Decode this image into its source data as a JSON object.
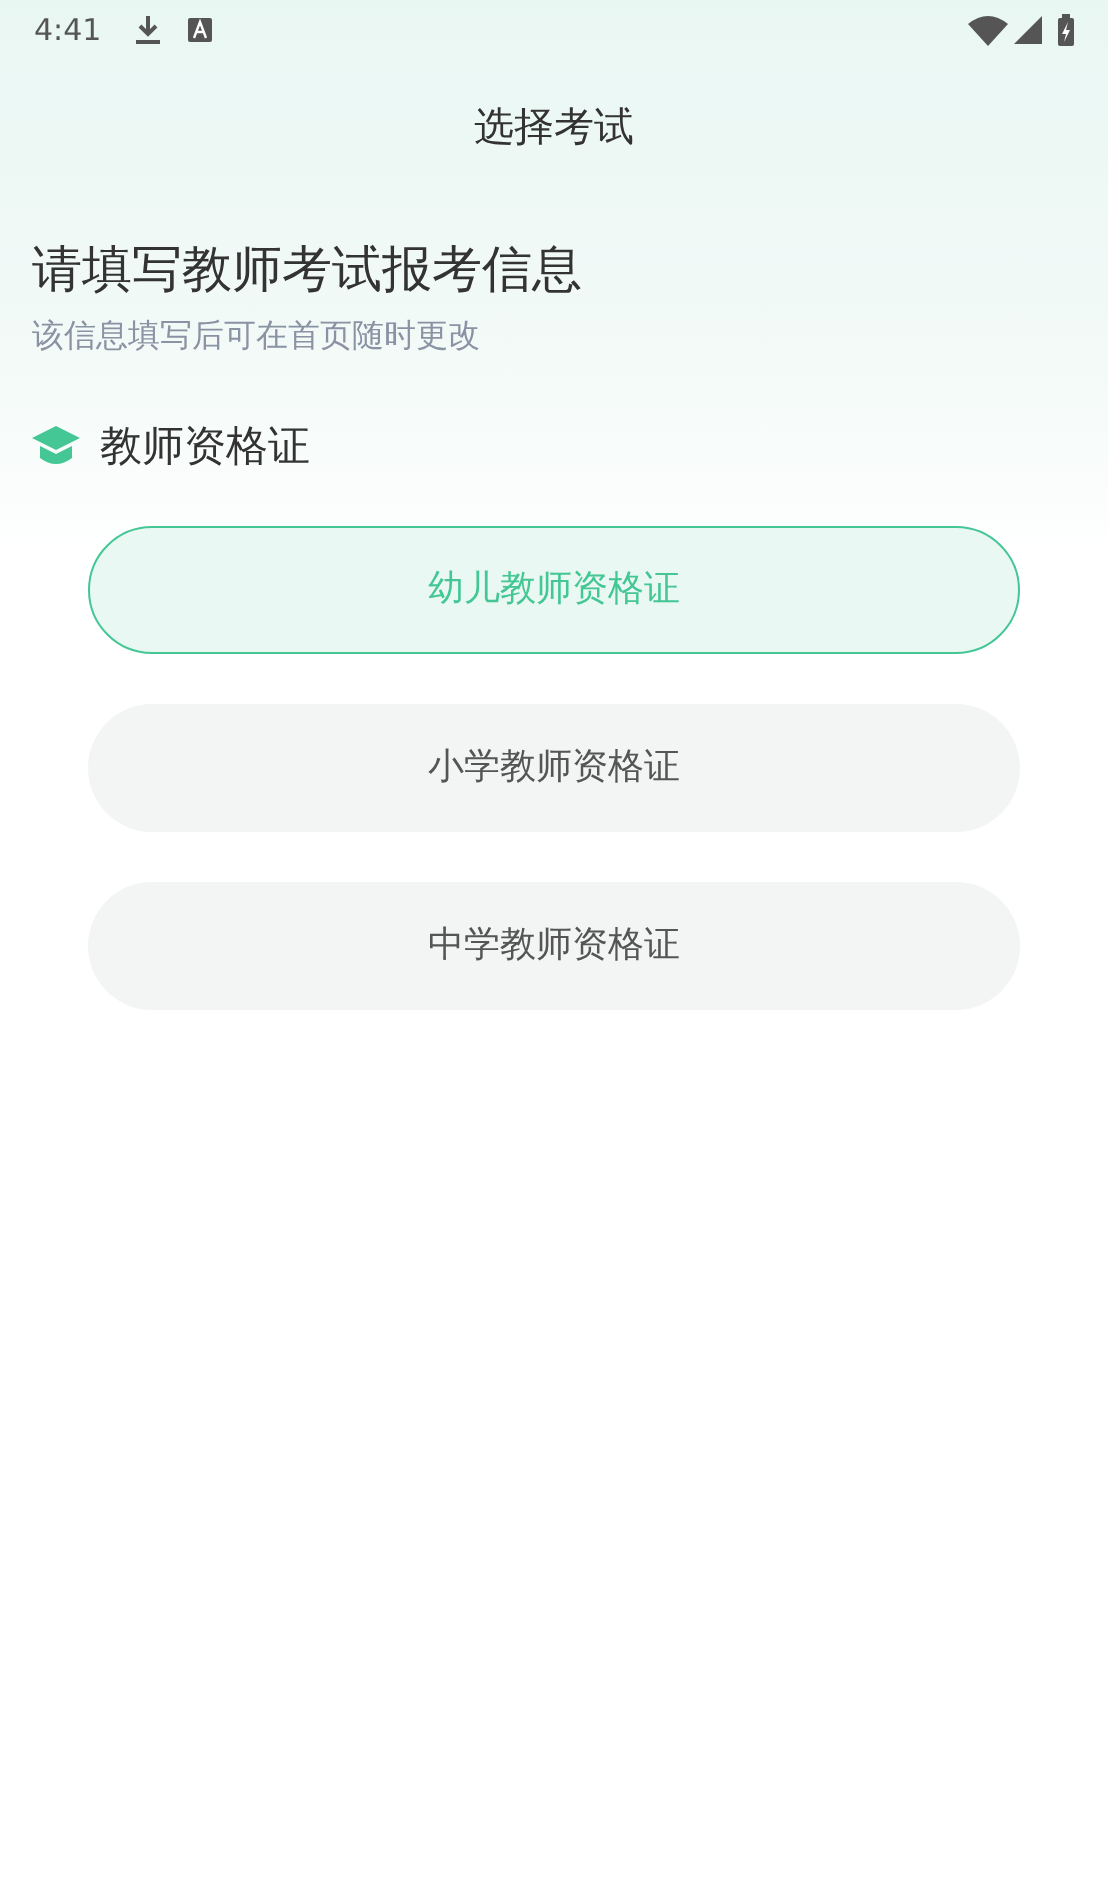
{
  "status_bar": {
    "time": "4:41"
  },
  "header": {
    "title": "选择考试"
  },
  "intro": {
    "heading": "请填写教师考试报考信息",
    "subtitle": "该信息填写后可在首页随时更改"
  },
  "section": {
    "title": "教师资格证"
  },
  "options": [
    {
      "label": "幼儿教师资格证",
      "selected": true
    },
    {
      "label": "小学教师资格证",
      "selected": false
    },
    {
      "label": "中学教师资格证",
      "selected": false
    }
  ]
}
